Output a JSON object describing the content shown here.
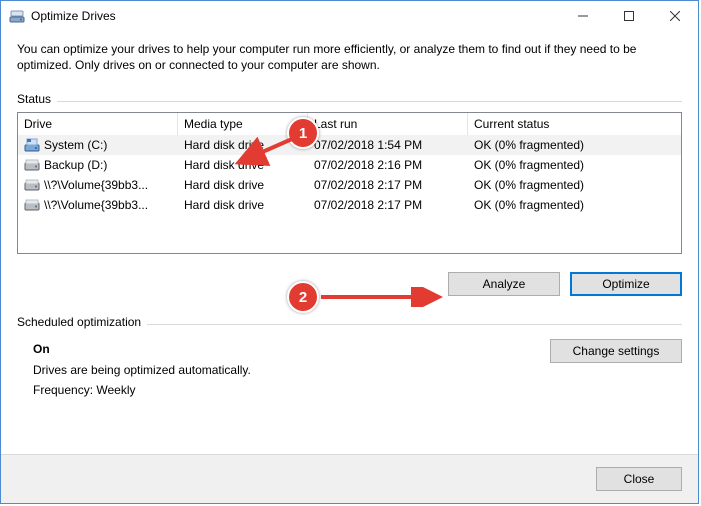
{
  "window": {
    "title": "Optimize Drives"
  },
  "description": "You can optimize your drives to help your computer run more efficiently, or analyze them to find out if they need to be optimized. Only drives on or connected to your computer are shown.",
  "status": {
    "legend": "Status",
    "columns": {
      "drive": "Drive",
      "media": "Media type",
      "last": "Last run",
      "status": "Current status"
    },
    "rows": [
      {
        "drive": "System (C:)",
        "media": "Hard disk drive",
        "last": "07/02/2018 1:54 PM",
        "status": "OK (0% fragmented)",
        "icon": "os"
      },
      {
        "drive": "Backup (D:)",
        "media": "Hard disk drive",
        "last": "07/02/2018 2:16 PM",
        "status": "OK (0% fragmented)",
        "icon": "hdd"
      },
      {
        "drive": "\\\\?\\Volume{39bb3...",
        "media": "Hard disk drive",
        "last": "07/02/2018 2:17 PM",
        "status": "OK (0% fragmented)",
        "icon": "hdd"
      },
      {
        "drive": "\\\\?\\Volume{39bb3...",
        "media": "Hard disk drive",
        "last": "07/02/2018 2:17 PM",
        "status": "OK (0% fragmented)",
        "icon": "hdd"
      }
    ],
    "buttons": {
      "analyze": "Analyze",
      "optimize": "Optimize"
    }
  },
  "scheduled": {
    "legend": "Scheduled optimization",
    "on_label": "On",
    "desc": "Drives are being optimized automatically.",
    "frequency": "Frequency: Weekly",
    "change": "Change settings"
  },
  "footer": {
    "close": "Close"
  },
  "annotations": {
    "b1": "1",
    "b2": "2"
  }
}
